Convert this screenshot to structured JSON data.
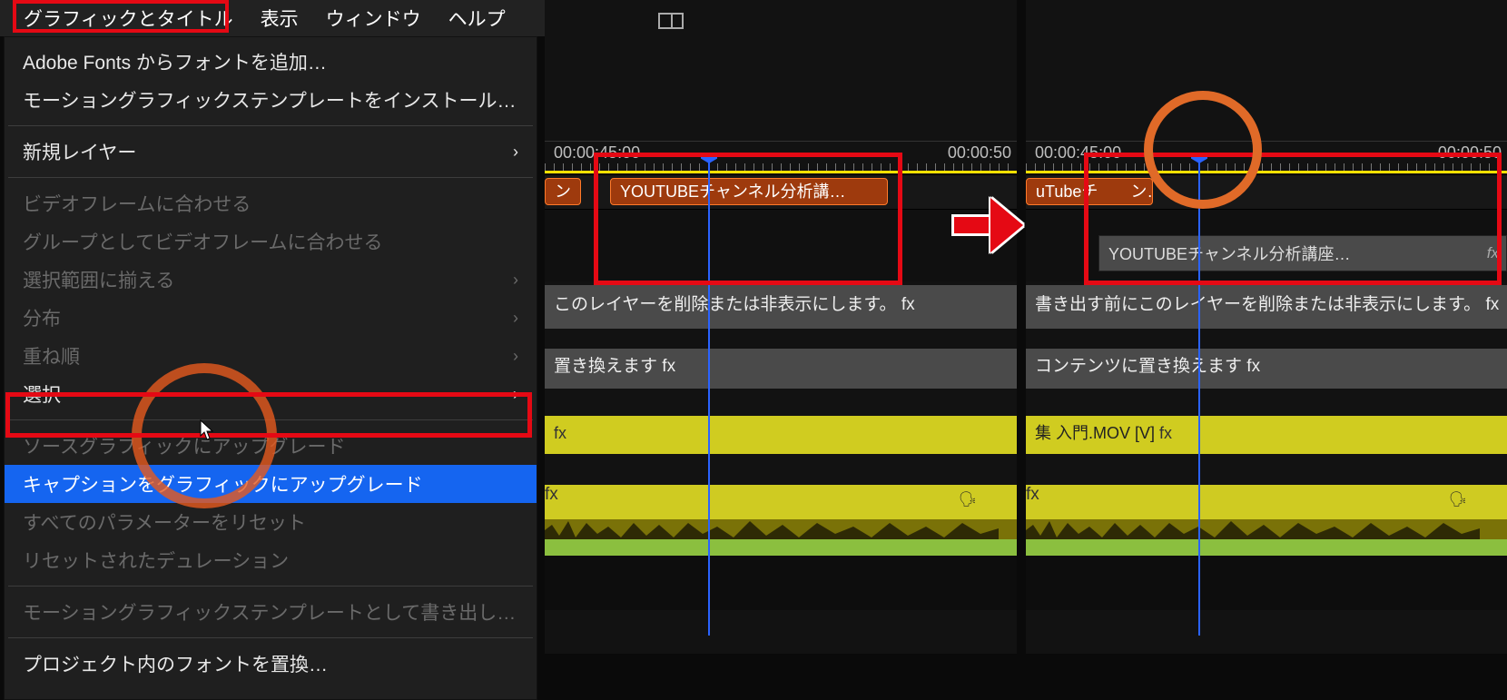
{
  "menubar": {
    "items": [
      "グラフィックとタイトル",
      "表示",
      "ウィンドウ",
      "ヘルプ"
    ]
  },
  "dropdown": {
    "add_fonts": "Adobe Fonts からフォントを追加…",
    "install_mogrt": "モーショングラフィックステンプレートをインストール…",
    "new_layer": "新規レイヤー",
    "fit_video_frame": "ビデオフレームに合わせる",
    "fit_group_video_frame": "グループとしてビデオフレームに合わせる",
    "align_selection": "選択範囲に揃える",
    "distribute": "分布",
    "arrange": "重ね順",
    "select": "選択",
    "upgrade_source": "ソースグラフィックにアップグレード",
    "upgrade_caption": "キャプションをグラフィックにアップグレード",
    "reset_params": "すべてのパラメーターをリセット",
    "reset_duration": "リセットされたデュレーション",
    "export_mogrt": "モーショングラフィックステンプレートとして書き出し…",
    "replace_fonts": "プロジェクト内のフォントを置換…"
  },
  "timeline_left": {
    "time_start": "00:00:45:00",
    "time_end": "00:00:50",
    "caption_prev": "ン",
    "caption_clip": "YOUTUBEチャンネル分析講…",
    "track_gray1": "このレイヤーを削除または非表示にします。",
    "track_gray2": "置き換えます",
    "fx": "fx"
  },
  "timeline_right": {
    "time_start": "00:00:45:00",
    "time_end": "00:00:50",
    "caption_clip_trunc": "uTubeチ　　ン…",
    "graphic_clip": "YOUTUBEチャンネル分析講座…",
    "track_gray1": "書き出す前にこのレイヤーを削除または非表示にします。",
    "track_gray2": "コンテンツに置き換えます",
    "track_video": "集 入門.MOV [V]",
    "fx": "fx"
  }
}
